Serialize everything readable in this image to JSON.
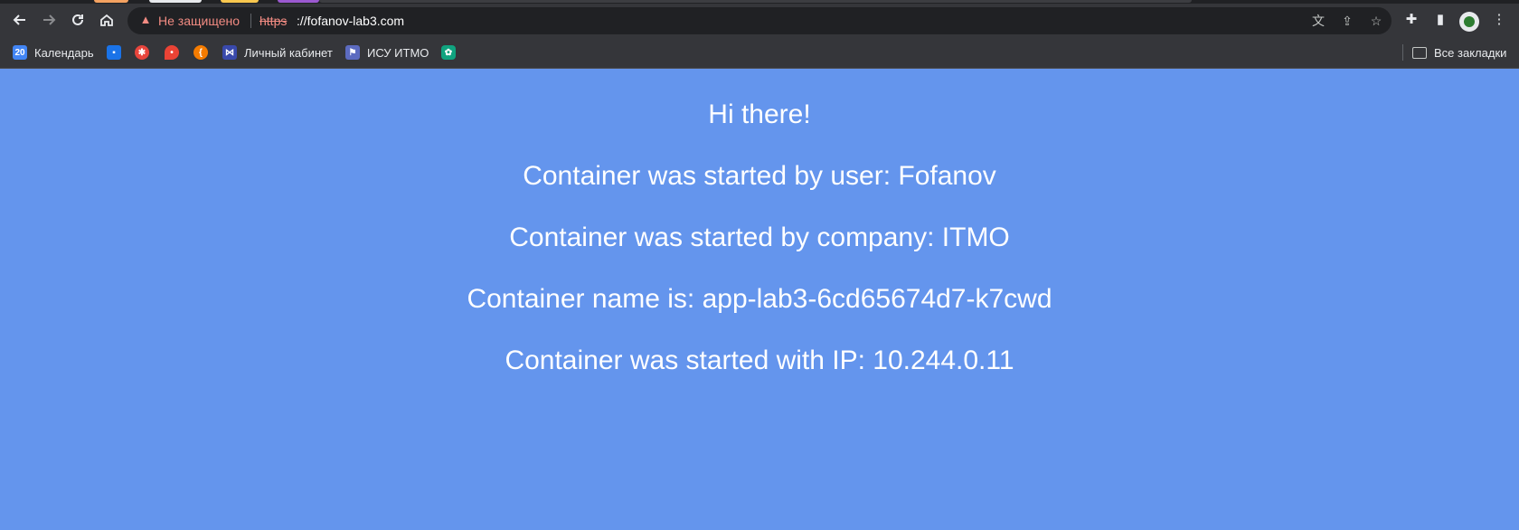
{
  "browser": {
    "nav": {
      "back_icon": "back-arrow-icon",
      "forward_icon": "forward-arrow-icon",
      "reload_icon": "reload-icon",
      "home_icon": "home-icon"
    },
    "omnibox": {
      "security_label": "Не защищено",
      "url_scheme": "https",
      "url_rest": "://fofanov-lab3.com"
    },
    "bookmarks": [
      {
        "label": "Календарь",
        "icon": "calendar-icon",
        "color": "#4285f4"
      },
      {
        "label": "",
        "icon": "chat-icon",
        "color": "#1a73e8"
      },
      {
        "label": "",
        "icon": "app-icon",
        "color": "#e8453c"
      },
      {
        "label": "",
        "icon": "maps-pin-icon",
        "color": "#ea4335"
      },
      {
        "label": "",
        "icon": "brace-icon",
        "color": "#f57c00"
      },
      {
        "label": "Личный кабинет",
        "icon": "portal-icon",
        "color": "#3949ab"
      },
      {
        "label": "ИСУ ИТМО",
        "icon": "itmo-icon",
        "color": "#5c6bc0"
      },
      {
        "label": "",
        "icon": "openai-icon",
        "color": "#10a37f"
      }
    ],
    "all_bookmarks_label": "Все закладки"
  },
  "page": {
    "background": "#6495ed",
    "lines": [
      "Hi there!",
      "Container was started by user: Fofanov",
      "Container was started by company: ITMO",
      "Container name is: app-lab3-6cd65674d7-k7cwd",
      "Container was started with IP: 10.244.0.11"
    ]
  }
}
